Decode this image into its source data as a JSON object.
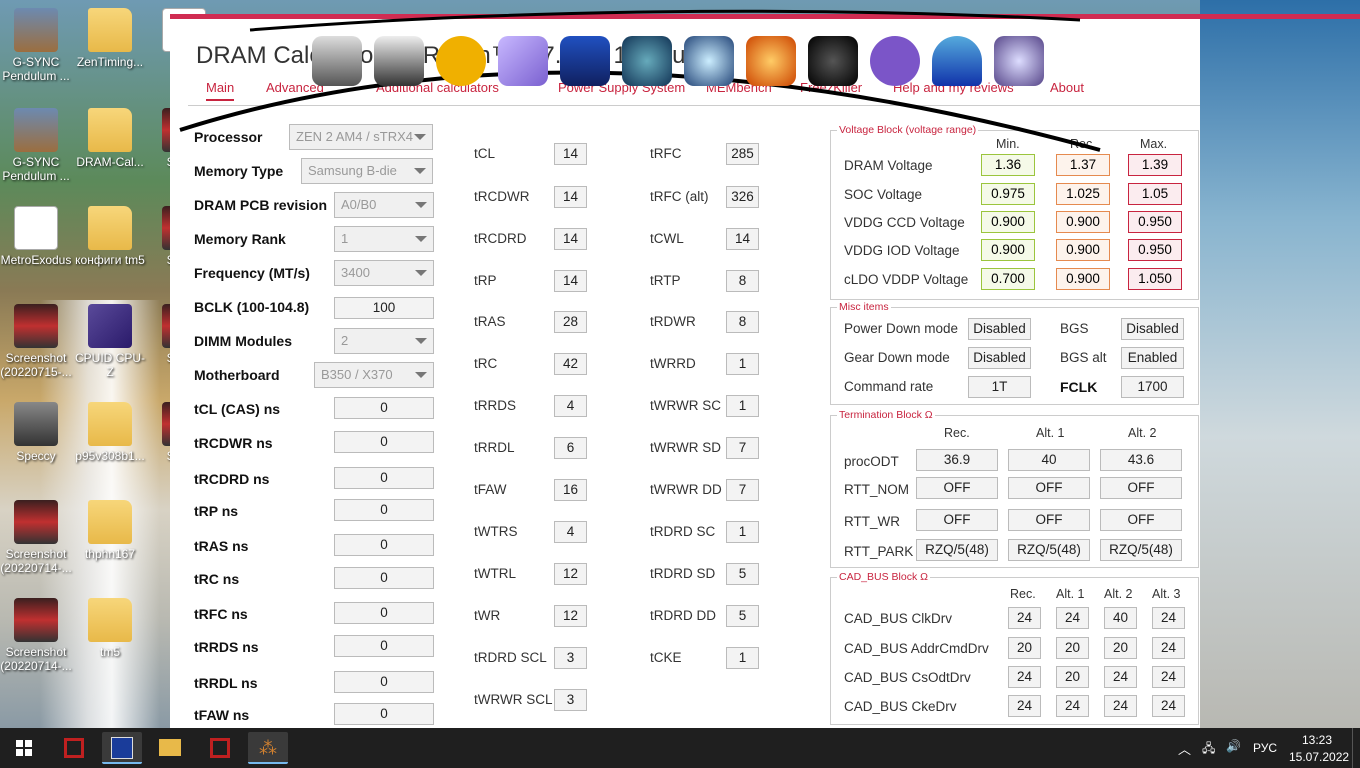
{
  "desktop": {
    "icons": [
      {
        "label": "G-SYNC Pendulum ..."
      },
      {
        "label": "ZenTiming..."
      },
      {
        "label": "Te"
      },
      {
        "label": "G-SYNC Pendulum ..."
      },
      {
        "label": "DRAM-Cal..."
      },
      {
        "label": "Sc (20"
      },
      {
        "label": "MetroExodus"
      },
      {
        "label": "конфиги tm5"
      },
      {
        "label": "Sc (20"
      },
      {
        "label": "Screenshot (20220715-..."
      },
      {
        "label": "CPUID CPU-Z"
      },
      {
        "label": "Sc (20"
      },
      {
        "label": "Speccy"
      },
      {
        "label": "p95v308b1..."
      },
      {
        "label": "Sc (20"
      },
      {
        "label": "Screenshot (20220714-..."
      },
      {
        "label": "thphn167"
      },
      {
        "label": "Screenshot (20220714-..."
      },
      {
        "label": "tm5"
      }
    ]
  },
  "window": {
    "title": "DRAM Calculator for Ryzen™ 1.7.3 by 1usmus",
    "tabs": [
      "Main",
      "Advanced",
      "Additional calculators",
      "Power Supply System",
      "MEMbench",
      "FreezKiller",
      "Help and my reviews",
      "About"
    ],
    "active_tab": "Main"
  },
  "left_panel": {
    "processor": {
      "label": "Processor",
      "value": "ZEN 2 AM4 / sTRX4"
    },
    "memory_type": {
      "label": "Memory Type",
      "value": "Samsung B-die"
    },
    "pcb_revision": {
      "label": "DRAM PCB revision",
      "value": "A0/B0"
    },
    "memory_rank": {
      "label": "Memory Rank",
      "value": "1"
    },
    "frequency": {
      "label": "Frequency (MT/s)",
      "value": "3400"
    },
    "bclk": {
      "label": "BCLK (100-104.8)",
      "value": "100"
    },
    "dimm_modules": {
      "label": "DIMM Modules",
      "value": "2"
    },
    "motherboard": {
      "label": "Motherboard",
      "value": "B350 / X370"
    },
    "ns_fields": [
      {
        "label": "tCL (CAS) ns",
        "value": "0"
      },
      {
        "label": "tRCDWR ns",
        "value": "0"
      },
      {
        "label": "tRCDRD ns",
        "value": "0"
      },
      {
        "label": "tRP ns",
        "value": "0"
      },
      {
        "label": "tRAS ns",
        "value": "0"
      },
      {
        "label": "tRC ns",
        "value": "0"
      },
      {
        "label": "tRFC ns",
        "value": "0"
      },
      {
        "label": "tRRDS ns",
        "value": "0"
      },
      {
        "label": "tRRDL ns",
        "value": "0"
      },
      {
        "label": "tFAW ns",
        "value": "0"
      }
    ]
  },
  "timings_col1": [
    {
      "label": "tCL",
      "value": "14"
    },
    {
      "label": "tRCDWR",
      "value": "14"
    },
    {
      "label": "tRCDRD",
      "value": "14"
    },
    {
      "label": "tRP",
      "value": "14"
    },
    {
      "label": "tRAS",
      "value": "28"
    },
    {
      "label": "tRC",
      "value": "42"
    },
    {
      "label": "tRRDS",
      "value": "4"
    },
    {
      "label": "tRRDL",
      "value": "6"
    },
    {
      "label": "tFAW",
      "value": "16"
    },
    {
      "label": "tWTRS",
      "value": "4"
    },
    {
      "label": "tWTRL",
      "value": "12"
    },
    {
      "label": "tWR",
      "value": "12"
    },
    {
      "label": "tRDRD SCL",
      "value": "3"
    },
    {
      "label": "tWRWR SCL",
      "value": "3"
    }
  ],
  "timings_col2": [
    {
      "label": "tRFC",
      "value": "285"
    },
    {
      "label": "tRFC (alt)",
      "value": "326"
    },
    {
      "label": "tCWL",
      "value": "14"
    },
    {
      "label": "tRTP",
      "value": "8"
    },
    {
      "label": "tRDWR",
      "value": "8"
    },
    {
      "label": "tWRRD",
      "value": "1"
    },
    {
      "label": "tWRWR SC",
      "value": "1"
    },
    {
      "label": "tWRWR SD",
      "value": "7"
    },
    {
      "label": "tWRWR DD",
      "value": "7"
    },
    {
      "label": "tRDRD SC",
      "value": "1"
    },
    {
      "label": "tRDRD SD",
      "value": "5"
    },
    {
      "label": "tRDRD DD",
      "value": "5"
    },
    {
      "label": "tCKE",
      "value": "1"
    }
  ],
  "voltage_block": {
    "title": "Voltage Block (voltage range)",
    "headers": [
      "Min.",
      "Rec.",
      "Max."
    ],
    "rows": [
      {
        "label": "DRAM Voltage",
        "min": "1.36",
        "rec": "1.37",
        "max": "1.39"
      },
      {
        "label": "SOC Voltage",
        "min": "0.975",
        "rec": "1.025",
        "max": "1.05"
      },
      {
        "label": "VDDG  CCD Voltage",
        "min": "0.900",
        "rec": "0.900",
        "max": "0.950"
      },
      {
        "label": "VDDG  IOD Voltage",
        "min": "0.900",
        "rec": "0.900",
        "max": "0.950"
      },
      {
        "label": "cLDO VDDP Voltage",
        "min": "0.700",
        "rec": "0.900",
        "max": "1.050"
      }
    ]
  },
  "misc_block": {
    "title": "Misc items",
    "power_down": {
      "label": "Power Down mode",
      "value": "Disabled"
    },
    "gear_down": {
      "label": "Gear Down mode",
      "value": "Disabled"
    },
    "command_rate": {
      "label": "Command rate",
      "value": "1T"
    },
    "bgs": {
      "label": "BGS",
      "value": "Disabled"
    },
    "bgs_alt": {
      "label": "BGS alt",
      "value": "Enabled"
    },
    "fclk": {
      "label": "FCLK",
      "value": "1700"
    }
  },
  "termination_block": {
    "title": "Termination Block Ω",
    "headers": [
      "Rec.",
      "Alt. 1",
      "Alt. 2"
    ],
    "rows": [
      {
        "label": "procODT",
        "values": [
          "36.9",
          "40",
          "43.6"
        ]
      },
      {
        "label": "RTT_NOM",
        "values": [
          "OFF",
          "OFF",
          "OFF"
        ]
      },
      {
        "label": "RTT_WR",
        "values": [
          "OFF",
          "OFF",
          "OFF"
        ]
      },
      {
        "label": "RTT_PARK",
        "values": [
          "RZQ/5(48)",
          "RZQ/5(48)",
          "RZQ/5(48)"
        ]
      }
    ]
  },
  "cad_block": {
    "title": "CAD_BUS Block Ω",
    "headers": [
      "Rec.",
      "Alt. 1",
      "Alt. 2",
      "Alt. 3"
    ],
    "rows": [
      {
        "label": "CAD_BUS ClkDrv",
        "values": [
          "24",
          "24",
          "40",
          "24"
        ]
      },
      {
        "label": "CAD_BUS AddrCmdDrv",
        "values": [
          "20",
          "20",
          "20",
          "24"
        ]
      },
      {
        "label": "CAD_BUS CsOdtDrv",
        "values": [
          "24",
          "20",
          "24",
          "24"
        ]
      },
      {
        "label": "CAD_BUS CkeDrv",
        "values": [
          "24",
          "24",
          "24",
          "24"
        ]
      }
    ]
  },
  "taskbar": {
    "language": "РУС",
    "time": "13:23",
    "date": "15.07.2022"
  },
  "colors": {
    "accent": "#c8243f",
    "min_border": "#9bc53d",
    "rec_border": "#e58a4f",
    "max_border": "#c8243f"
  }
}
